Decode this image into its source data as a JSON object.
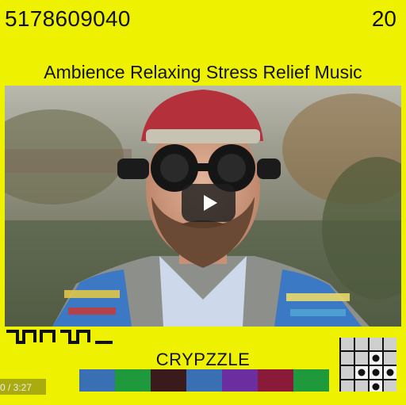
{
  "header": {
    "id_number": "5178609040",
    "count": "20"
  },
  "video": {
    "title": "Ambience Relaxing Stress Relief Music",
    "play_icon": "play-icon"
  },
  "player": {
    "time": "0 / 3:27"
  },
  "footer": {
    "brand": "CRYPZZLE",
    "swatch_colors": [
      "#3a6fb3",
      "#1e9a3c",
      "#3a1a1a",
      "#3a6fb3",
      "#6a2ea0",
      "#8a1a3a",
      "#1e9a3c"
    ],
    "grid_pattern": [
      [
        0,
        0,
        0,
        0
      ],
      [
        0,
        0,
        1,
        0
      ],
      [
        0,
        1,
        1,
        1
      ],
      [
        0,
        0,
        1,
        0
      ]
    ]
  }
}
